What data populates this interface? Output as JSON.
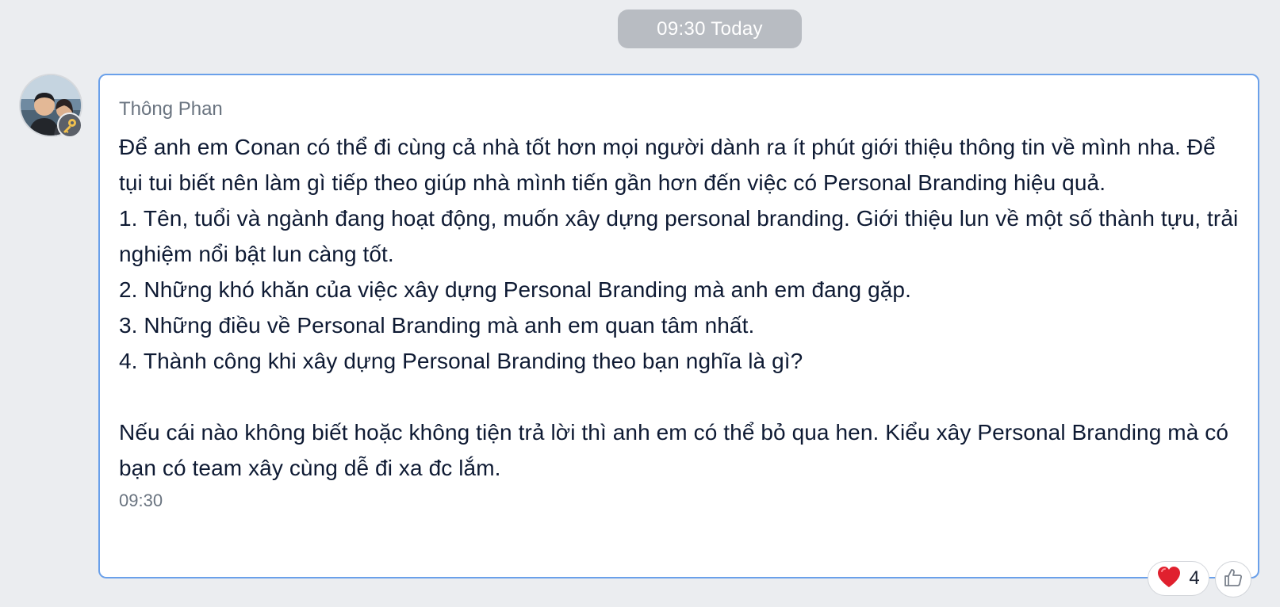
{
  "date_separator": "09:30 Today",
  "message": {
    "sender": "Thông Phan",
    "text": "Để anh em Conan có thể đi cùng cả nhà tốt hơn mọi người dành ra ít phút giới thiệu thông tin về mình nha. Để tụi tui biết nên làm gì tiếp theo giúp nhà mình tiến gần hơn đến việc có Personal Branding hiệu quả.\n1. Tên, tuổi và ngành đang hoạt động, muốn xây dựng personal branding. Giới thiệu lun về một số thành tựu, trải nghiệm nổi bật lun càng tốt.\n2. Những khó khăn của việc xây dựng Personal Branding mà anh em đang gặp.\n3. Những điều về Personal Branding mà anh em quan tâm nhất.\n4. Thành công khi xây dựng Personal Branding theo bạn nghĩa là gì?\n\nNếu cái nào không biết hoặc không tiện trả lời thì anh em có thể bỏ qua hen. Kiểu xây Personal Branding mà có bạn có team xây cùng dễ đi xa đc lắm.",
    "time": "09:30",
    "border_color": "#6aa0ea"
  },
  "reactions": {
    "heart": {
      "icon": "heart-icon",
      "count": "4",
      "color": "#e0202e"
    },
    "like_button_icon": "thumbs-up-icon"
  }
}
